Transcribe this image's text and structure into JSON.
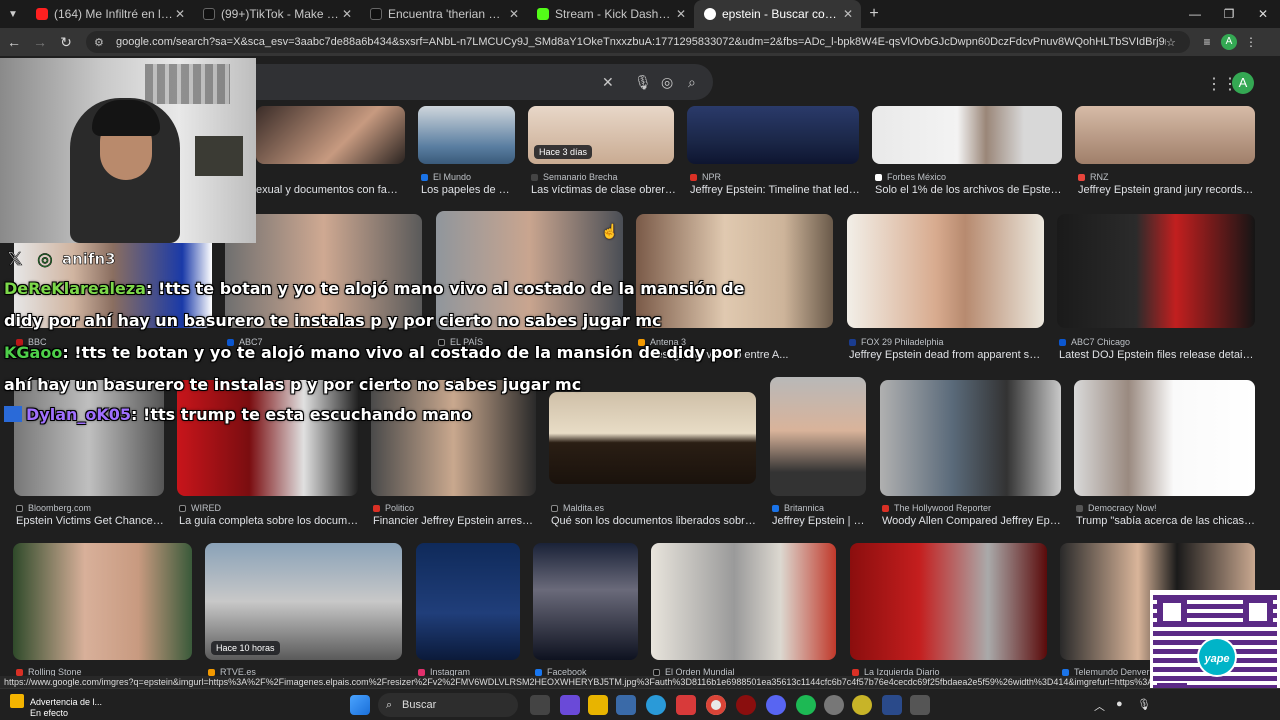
{
  "browser": {
    "tabs": [
      {
        "title": "(164) Me Infiltré en la Comunid",
        "fav": "#ff2020"
      },
      {
        "title": "(99+)TikTok - Make Your Day",
        "fav": "#111111"
      },
      {
        "title": "Encuentra 'therian en lima' en T",
        "fav": "#111111"
      },
      {
        "title": "Stream - Kick Dashboard",
        "fav": "#53fc18"
      },
      {
        "title": "epstein - Buscar con Google",
        "fav": "#ffffff"
      }
    ],
    "url": "google.com/search?sa=X&sca_esv=3aabc7de88a6b434&sxsrf=ANbL-n7LMCUCy9J_SMd8aY1OkeTnxxzbuA:1771295833072&udm=2&fbs=ADc_l-bpk8W4E-qsVlOvbGJcDwpn60DczFdcvPnuv8WQohHLTbSVIdBrj9mdwFjfwlgEUgS3rVmfuCXEBMRJMD3ur3wa2tC...",
    "account_initial": "A"
  },
  "results": {
    "row1": [
      {
        "source": "",
        "caption": "exual y documentos con famos...",
        "color": "#ffffff"
      },
      {
        "source": "El Mundo",
        "caption": "Los papeles de Ep...",
        "color": "#1a73e8"
      },
      {
        "source": "Semanario Brecha",
        "caption": "Las víctimas de clase obrera d...",
        "color": "#111111",
        "badge": "Hace 3 días"
      },
      {
        "source": "NPR",
        "caption": "Jeffrey Epstein: Timeline that led to ...",
        "color": "#d93025"
      },
      {
        "source": "Forbes México",
        "caption": "Solo el 1% de los archivos de Epstein se...",
        "color": "#ffffff"
      },
      {
        "source": "RNZ",
        "caption": "Jeffrey Epstein grand jury records to r...",
        "color": "#e8453c"
      }
    ],
    "row2": [
      {
        "source": "BBC",
        "caption": "",
        "color": "#bb1919"
      },
      {
        "source": "ABC7",
        "caption": "",
        "color": "#0b57d0"
      },
      {
        "source": "EL PAÍS",
        "caption": "",
        "color": "#111111"
      },
      {
        "source": "Antena 3",
        "caption": "ue testigo del vínculo entre A...",
        "color": "#f29900"
      },
      {
        "source": "FOX 29 Philadelphia",
        "caption": "Jeffrey Epstein dead from apparent suicid...",
        "color": "#1a3c8f"
      },
      {
        "source": "ABC7 Chicago",
        "caption": "Latest DOJ Epstein files release details inv...",
        "color": "#0b57d0"
      }
    ],
    "row3": [
      {
        "source": "Bloomberg.com",
        "caption": "Epstein Victims Get Chance to ...",
        "color": "#111111"
      },
      {
        "source": "WIRED",
        "caption": "La guía completa sobre los documento...",
        "color": "#111111"
      },
      {
        "source": "Politico",
        "caption": "Financier Jeffrey Epstein arrested ...",
        "color": "#d93025"
      },
      {
        "source": "Maldita.es",
        "caption": "Qué son los documentos liberados sobre Jeff...",
        "color": "#111111"
      },
      {
        "source": "Britannica",
        "caption": "Jeffrey Epstein | D...",
        "color": "#1a73e8"
      },
      {
        "source": "The Hollywood Reporter",
        "caption": "Woody Allen Compared Jeffrey Epstei...",
        "color": "#d93025"
      },
      {
        "source": "Democracy Now!",
        "caption": "Trump \"sabía acerca de las chicas\": cr...",
        "color": "#555555"
      }
    ],
    "row4": [
      {
        "source": "Rolling Stone",
        "color": "#d93025"
      },
      {
        "source": "RTVE.es",
        "color": "#f29900",
        "badge": "Hace 10 horas"
      },
      {
        "source": "Instagram",
        "color": "#e1306c"
      },
      {
        "source": "Facebook",
        "color": "#1877f2"
      },
      {
        "source": "El Orden Mundial",
        "color": "#111111"
      },
      {
        "source": "La Izquierda Diario",
        "color": "#d93025"
      },
      {
        "source": "Telemundo Denver",
        "color": "#1a73e8"
      }
    ]
  },
  "overlay": {
    "handle": "anifn3",
    "chat": [
      {
        "user": "DeReKlarealeza",
        "message": ": !tts te botan y yo te alojó mano vivo al costado de la mansión de",
        "cont": "didy por ahí hay un basurero te instalas p y por cierto no sabes jugar mc"
      },
      {
        "user": "KGaoo",
        "message": ": !tts te botan y yo te alojó mano vivo al costado de la mansión de didy por",
        "cont": "ahí hay un basurero te instalas p y por cierto no sabes jugar mc"
      },
      {
        "user": "Dylan_oK05",
        "message": ": !tts trump te esta escuchando mano"
      }
    ],
    "qr_label": "yape"
  },
  "status_url": "https://www.google.com/imgres?q=epstein&imgurl=https%3A%2F%2Fimagenes.elpais.com%2Fresizer%2Fv2%2FMV6WDLVLRSM2HEOXWHERYBJ5TM.jpg%3Fauth%3D8116b1e6988501ea35613c1144cfc6b7c4f57b76e4cecdc69f25fbdaea2e5f59%26width%3D414&imgrefurl=https%3A%2F%2Felpais.com%2Fsociedad%2F2019%",
  "taskbar": {
    "notice_title": "Advertencia de l...",
    "notice_sub": "En efecto",
    "search_label": "Buscar"
  }
}
